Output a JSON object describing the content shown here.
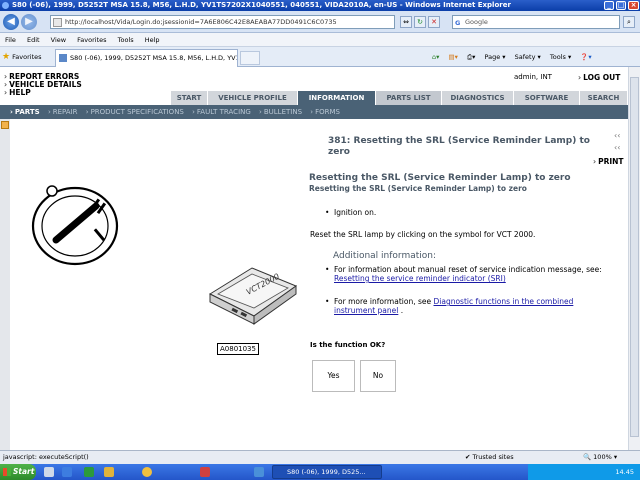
{
  "window": {
    "title": "S80 (-06), 1999, D5252T MSA 15.8, M56, L.H.D, YV1TS7202X1040551, 040551, VIDA2010A, en-US - Windows Internet Explorer",
    "address": "http://localhost/Vida/Login.do;jsessionid=7A6E806C42E8AEABA77DD0491C6C0735",
    "search_placeholder": "Google"
  },
  "menu": [
    "File",
    "Edit",
    "View",
    "Favorites",
    "Tools",
    "Help"
  ],
  "favorites_label": "Favorites",
  "tab_title": "S80 (-06), 1999, D5252T MSA 15.8, M56, L.H.D, YV1...",
  "commands": [
    "Page ▾",
    "Safety ▾",
    "Tools ▾",
    "❓▾"
  ],
  "top_links": [
    "REPORT ERRORS",
    "VEHICLE DETAILS",
    "HELP"
  ],
  "user": {
    "name": "admin, INT",
    "logout": "LOG OUT"
  },
  "nav_tabs": [
    {
      "label": "START"
    },
    {
      "label": "VEHICLE PROFILE"
    },
    {
      "label": "INFORMATION",
      "active": true
    },
    {
      "label": "PARTS LIST"
    },
    {
      "label": "DIAGNOSTICS"
    },
    {
      "label": "SOFTWARE"
    },
    {
      "label": "SEARCH"
    }
  ],
  "sub_nav": [
    {
      "label": "PARTS",
      "active": true
    },
    {
      "label": "REPAIR"
    },
    {
      "label": "PRODUCT SPECIFICATIONS"
    },
    {
      "label": "FAULT TRACING"
    },
    {
      "label": "BULLETINS"
    },
    {
      "label": "FORMS"
    }
  ],
  "doc": {
    "header": "381: Resetting the SRL (Service Reminder Lamp) to zero",
    "print": "PRINT",
    "title": "Resetting the SRL (Service Reminder Lamp) to zero",
    "subtitle": "Resetting the SRL (Service Reminder Lamp) to zero",
    "bullet1": "Ignition on.",
    "para": "Reset the SRL lamp by clicking on the symbol for VCT 2000.",
    "additional_heading": "Additional information:",
    "info1_text": "For information about manual reset of service indication message, see:",
    "info1_link": "Resetting the service reminder indicator (SRI)",
    "info2_text": "For more information, see",
    "info2_link": "Diagnostic functions in the combined instrument panel",
    "info2_suffix": ".",
    "question": "Is the function OK?",
    "yes": "Yes",
    "no": "No",
    "image_label": "A0801035",
    "device_label": "VCT2000"
  },
  "status": {
    "left": "javascript: executeScript()",
    "zone": "Trusted sites",
    "zoom": "100%"
  },
  "taskbar": {
    "start": "Start",
    "item": "S80 (-06), 1999, D525...",
    "clock": "14.45"
  }
}
